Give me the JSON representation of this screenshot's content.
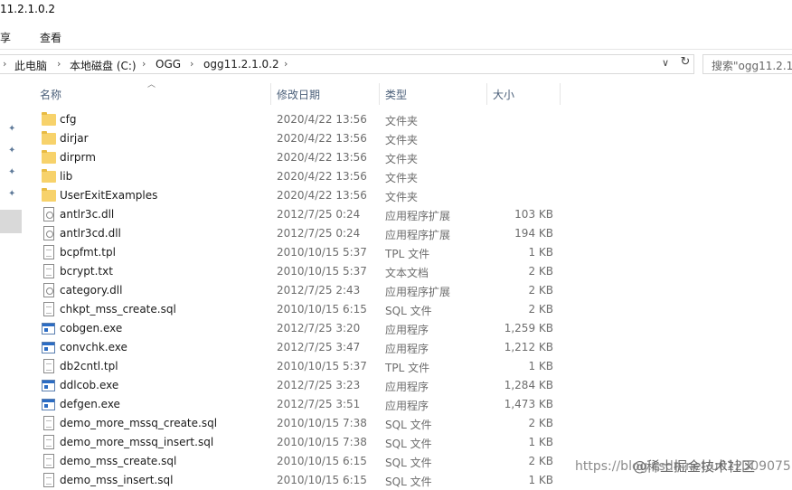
{
  "window": {
    "title": "11.2.1.0.2"
  },
  "ribbon": {
    "tabs": [
      "享",
      "查看"
    ]
  },
  "address": {
    "segments": [
      "此电脑",
      "本地磁盘 (C:)",
      "OGG",
      "ogg11.2.1.0.2"
    ],
    "search_placeholder": "搜索\"ogg11.2.1."
  },
  "columns": {
    "name": "名称",
    "date": "修改日期",
    "type": "类型",
    "size": "大小"
  },
  "files": [
    {
      "name": "cfg",
      "date": "2020/4/22 13:56",
      "type": "文件夹",
      "size": "",
      "icon": "folder"
    },
    {
      "name": "dirjar",
      "date": "2020/4/22 13:56",
      "type": "文件夹",
      "size": "",
      "icon": "folder"
    },
    {
      "name": "dirprm",
      "date": "2020/4/22 13:56",
      "type": "文件夹",
      "size": "",
      "icon": "folder"
    },
    {
      "name": "lib",
      "date": "2020/4/22 13:56",
      "type": "文件夹",
      "size": "",
      "icon": "folder"
    },
    {
      "name": "UserExitExamples",
      "date": "2020/4/22 13:56",
      "type": "文件夹",
      "size": "",
      "icon": "folder"
    },
    {
      "name": "antlr3c.dll",
      "date": "2012/7/25 0:24",
      "type": "应用程序扩展",
      "size": "103 KB",
      "icon": "dll"
    },
    {
      "name": "antlr3cd.dll",
      "date": "2012/7/25 0:24",
      "type": "应用程序扩展",
      "size": "194 KB",
      "icon": "dll"
    },
    {
      "name": "bcpfmt.tpl",
      "date": "2010/10/15 5:37",
      "type": "TPL 文件",
      "size": "1 KB",
      "icon": "doc"
    },
    {
      "name": "bcrypt.txt",
      "date": "2010/10/15 5:37",
      "type": "文本文档",
      "size": "2 KB",
      "icon": "doc"
    },
    {
      "name": "category.dll",
      "date": "2012/7/25 2:43",
      "type": "应用程序扩展",
      "size": "2 KB",
      "icon": "dll"
    },
    {
      "name": "chkpt_mss_create.sql",
      "date": "2010/10/15 6:15",
      "type": "SQL 文件",
      "size": "2 KB",
      "icon": "doc"
    },
    {
      "name": "cobgen.exe",
      "date": "2012/7/25 3:20",
      "type": "应用程序",
      "size": "1,259 KB",
      "icon": "exe"
    },
    {
      "name": "convchk.exe",
      "date": "2012/7/25 3:47",
      "type": "应用程序",
      "size": "1,212 KB",
      "icon": "exe"
    },
    {
      "name": "db2cntl.tpl",
      "date": "2010/10/15 5:37",
      "type": "TPL 文件",
      "size": "1 KB",
      "icon": "doc"
    },
    {
      "name": "ddlcob.exe",
      "date": "2012/7/25 3:23",
      "type": "应用程序",
      "size": "1,284 KB",
      "icon": "exe"
    },
    {
      "name": "defgen.exe",
      "date": "2012/7/25 3:51",
      "type": "应用程序",
      "size": "1,473 KB",
      "icon": "exe"
    },
    {
      "name": "demo_more_mssq_create.sql",
      "date": "2010/10/15 7:38",
      "type": "SQL 文件",
      "size": "2 KB",
      "icon": "doc"
    },
    {
      "name": "demo_more_mssq_insert.sql",
      "date": "2010/10/15 7:38",
      "type": "SQL 文件",
      "size": "1 KB",
      "icon": "doc"
    },
    {
      "name": "demo_mss_create.sql",
      "date": "2010/10/15 6:15",
      "type": "SQL 文件",
      "size": "2 KB",
      "icon": "doc"
    },
    {
      "name": "demo_mss_insert.sql",
      "date": "2010/10/15 6:15",
      "type": "SQL 文件",
      "size": "1 KB",
      "icon": "doc"
    }
  ],
  "watermark": {
    "url": "https://blog.csdn.net/u012309075",
    "brand": "@稀土掘金技术社区"
  }
}
